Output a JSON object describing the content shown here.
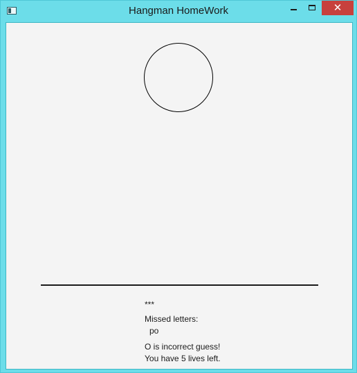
{
  "window": {
    "title": "Hangman HomeWork",
    "close_glyph": "✕",
    "accent_color": "#6cdde9",
    "close_color": "#c7413d"
  },
  "game": {
    "word_mask": "***",
    "missed_label": "Missed letters:",
    "missed_letters": "po",
    "feedback": "O is incorrect guess!",
    "lives_message": "You have 5 lives left."
  }
}
